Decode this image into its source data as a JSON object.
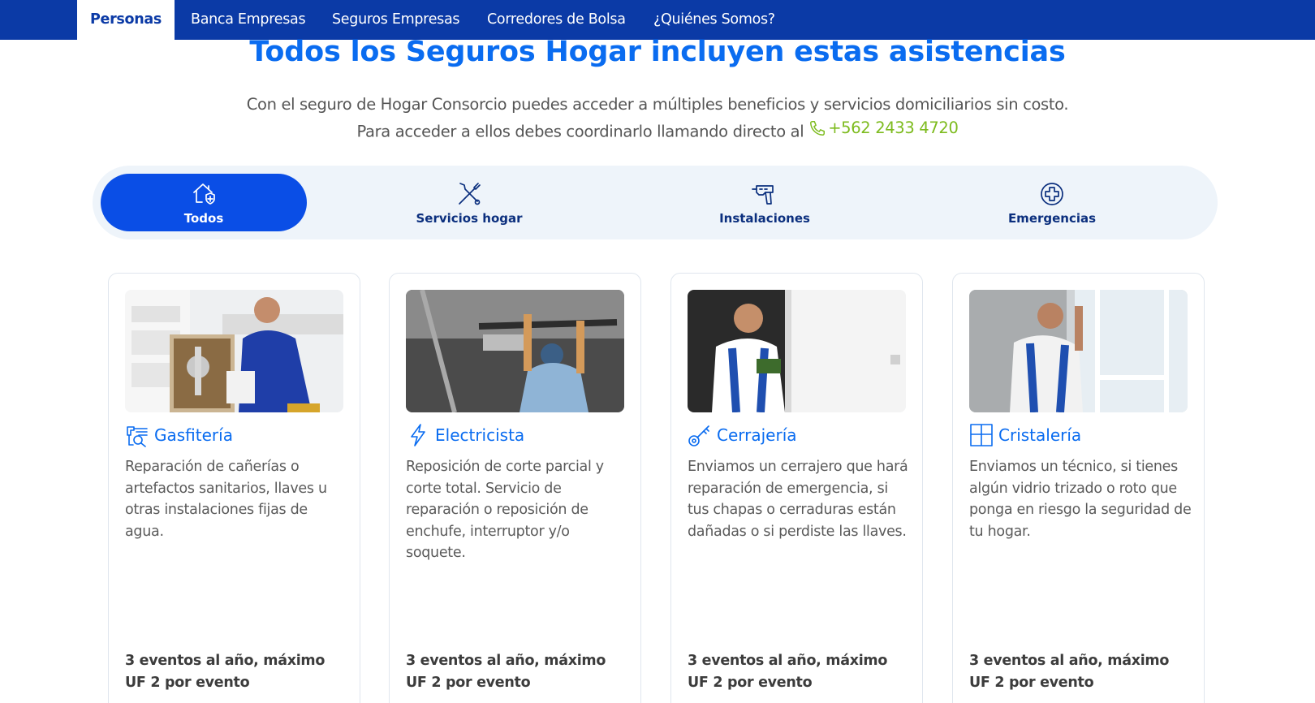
{
  "nav": {
    "tabs": [
      {
        "label": "Personas"
      },
      {
        "label": "Banca Empresas"
      },
      {
        "label": "Seguros Empresas"
      },
      {
        "label": "Corredores de Bolsa"
      },
      {
        "label": "¿Quiénes Somos?"
      }
    ]
  },
  "hero": {
    "title": "Todos los Seguros Hogar incluyen estas asistencias",
    "line1": "Con el seguro de Hogar Consorcio puedes acceder a múltiples beneficios y servicios domiciliarios sin costo.",
    "line2": "Para acceder a ellos debes coordinarlo llamando directo al",
    "phone": "+562 2433 4720"
  },
  "filters": [
    {
      "label": "Todos",
      "icon": "home-shield-icon"
    },
    {
      "label": "Servicios hogar",
      "icon": "tools-icon"
    },
    {
      "label": "Instalaciones",
      "icon": "drill-icon"
    },
    {
      "label": "Emergencias",
      "icon": "medical-cross-icon"
    }
  ],
  "cards": [
    {
      "title": "Gasfitería",
      "icon": "plumbing-icon",
      "description": "Reparación de cañerías o artefactos sanitarios, llaves u otras instalaciones fijas de agua.",
      "footer": "3 eventos al año, máximo UF 2 por evento"
    },
    {
      "title": "Electricista",
      "icon": "lightning-icon",
      "description": "Reposición de corte parcial y corte total. Servicio de reparación o reposición de enchufe, interruptor y/o soquete.",
      "footer": "3 eventos al año, máximo UF 2 por evento"
    },
    {
      "title": "Cerrajería",
      "icon": "key-icon",
      "description": "Enviamos un cerrajero que hará reparación de emergencia, si tus chapas o cerraduras están dañadas o si perdiste las llaves.",
      "footer": "3 eventos al año, máximo UF 2 por evento"
    },
    {
      "title": "Cristalería",
      "icon": "window-icon",
      "description": "Enviamos un técnico, si tienes algún vidrio trizado o roto que ponga en riesgo la seguridad de tu hogar.",
      "footer": "3 eventos al año, máximo UF 2 por evento"
    }
  ],
  "colors": {
    "nav_bg": "#0b3aa6",
    "accent_blue": "#0a6cf0",
    "active_tab": "#0a4ee6",
    "phone_green": "#7dbb1e",
    "tabbar_bg": "#eef4fa"
  }
}
